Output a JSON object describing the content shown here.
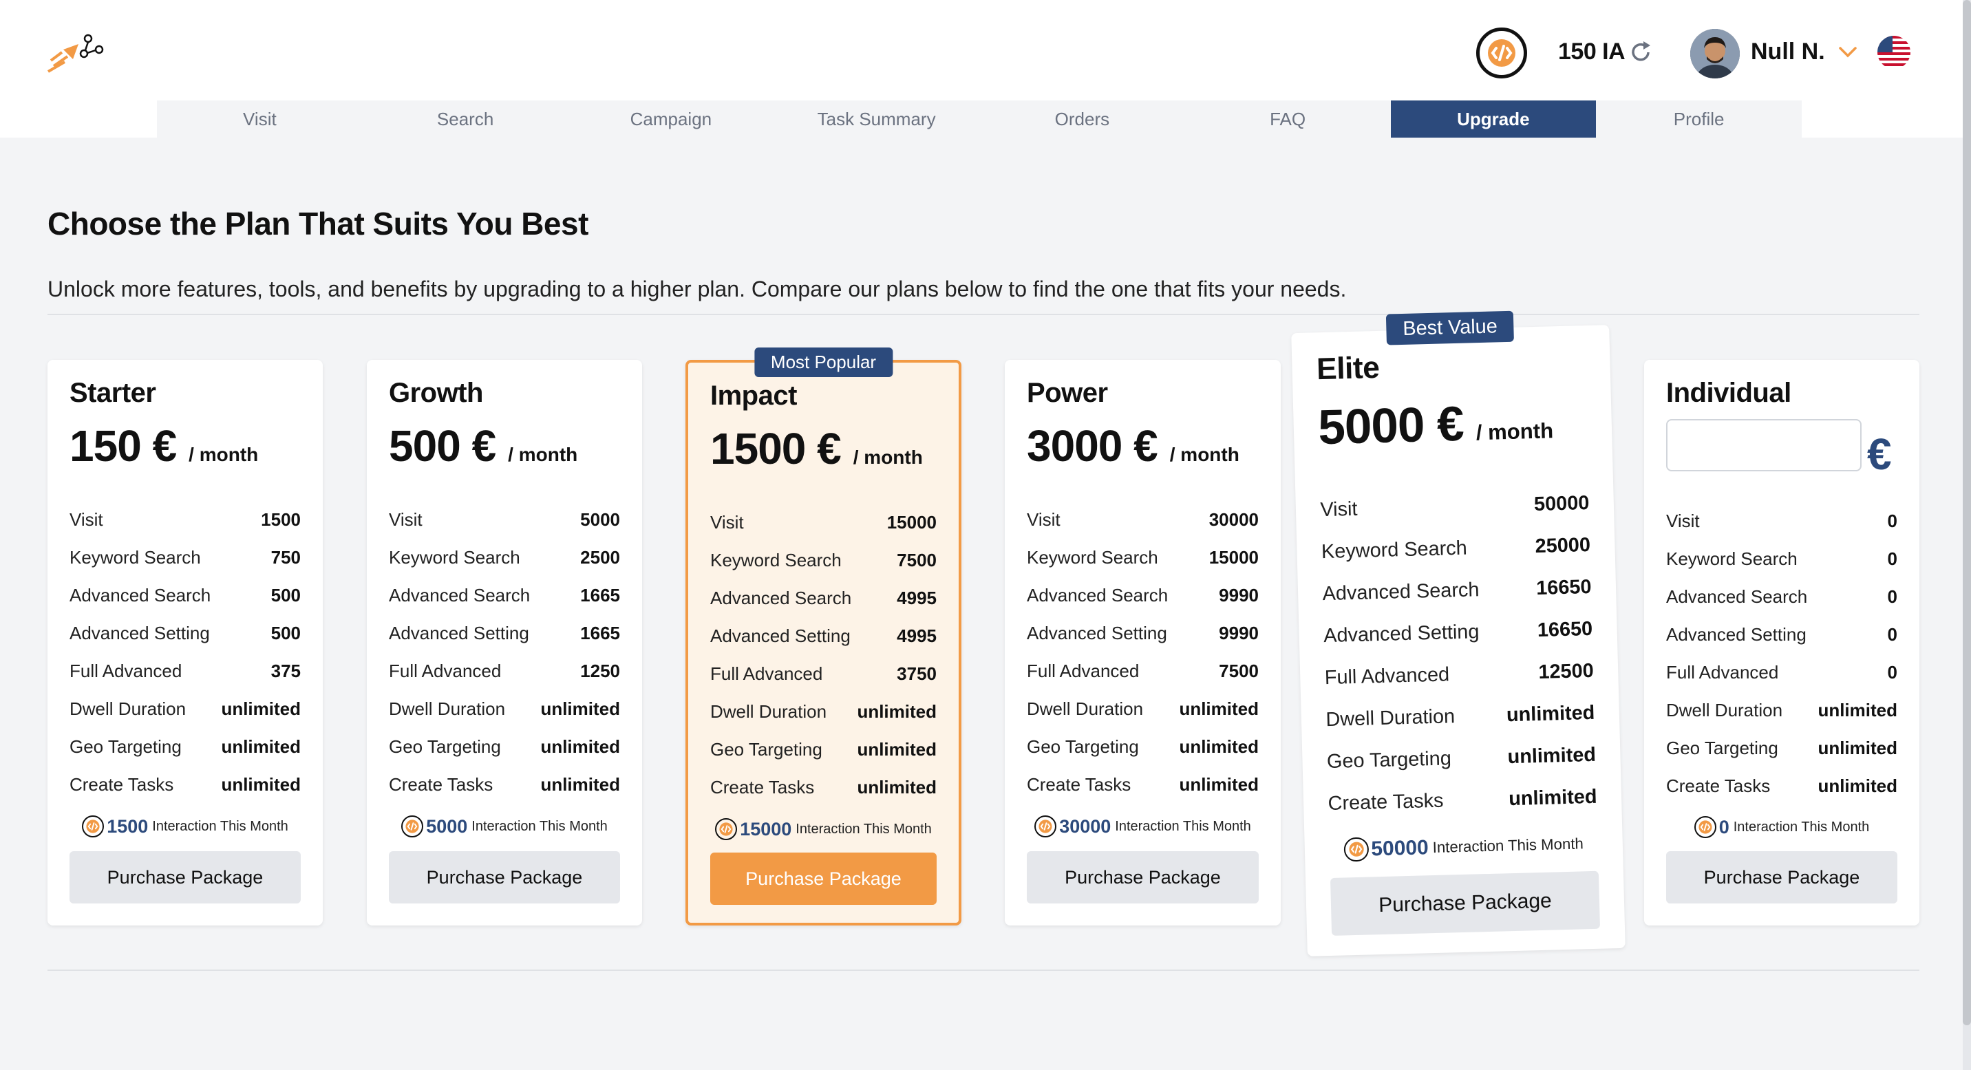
{
  "header": {
    "ia_count": "150 IA",
    "user_name": "Null N."
  },
  "nav": {
    "tabs": [
      {
        "label": "Visit",
        "active": false
      },
      {
        "label": "Search",
        "active": false
      },
      {
        "label": "Campaign",
        "active": false
      },
      {
        "label": "Task Summary",
        "active": false
      },
      {
        "label": "Orders",
        "active": false
      },
      {
        "label": "FAQ",
        "active": false
      },
      {
        "label": "Upgrade",
        "active": true
      },
      {
        "label": "Profile",
        "active": false
      }
    ]
  },
  "hero": {
    "title": "Choose the Plan That Suits You Best",
    "subtitle": "Unlock more features, tools, and benefits by upgrading to a higher plan. Compare our plans below to find the one that fits your needs."
  },
  "colors": {
    "primary": "#2c4a7c",
    "accent": "#f29a45",
    "popular_bg": "#fdf3e7"
  },
  "feature_labels": [
    "Visit",
    "Keyword Search",
    "Advanced Search",
    "Advanced Setting",
    "Full Advanced",
    "Dwell Duration",
    "Geo Targeting",
    "Create Tasks"
  ],
  "interaction_suffix": "Interaction This Month",
  "purchase_label": "Purchase Package",
  "plans": [
    {
      "name": "Starter",
      "price": "150 €",
      "period": "/ month",
      "values": [
        "1500",
        "750",
        "500",
        "500",
        "375",
        "unlimited",
        "unlimited",
        "unlimited"
      ],
      "interactions": "1500"
    },
    {
      "name": "Growth",
      "price": "500 €",
      "period": "/ month",
      "values": [
        "5000",
        "2500",
        "1665",
        "1665",
        "1250",
        "unlimited",
        "unlimited",
        "unlimited"
      ],
      "interactions": "5000"
    },
    {
      "name": "Impact",
      "badge": "Most Popular",
      "price": "1500 €",
      "period": "/ month",
      "values": [
        "15000",
        "7500",
        "4995",
        "4995",
        "3750",
        "unlimited",
        "unlimited",
        "unlimited"
      ],
      "interactions": "15000"
    },
    {
      "name": "Power",
      "price": "3000 €",
      "period": "/ month",
      "values": [
        "30000",
        "15000",
        "9990",
        "9990",
        "7500",
        "unlimited",
        "unlimited",
        "unlimited"
      ],
      "interactions": "30000"
    },
    {
      "name": "Elite",
      "badge": "Best Value",
      "price": "5000 €",
      "period": "/ month",
      "values": [
        "50000",
        "25000",
        "16650",
        "16650",
        "12500",
        "unlimited",
        "unlimited",
        "unlimited"
      ],
      "interactions": "50000"
    },
    {
      "name": "Individual",
      "currency": "€",
      "input_value": "",
      "values": [
        "0",
        "0",
        "0",
        "0",
        "0",
        "unlimited",
        "unlimited",
        "unlimited"
      ],
      "interactions": "0"
    }
  ]
}
